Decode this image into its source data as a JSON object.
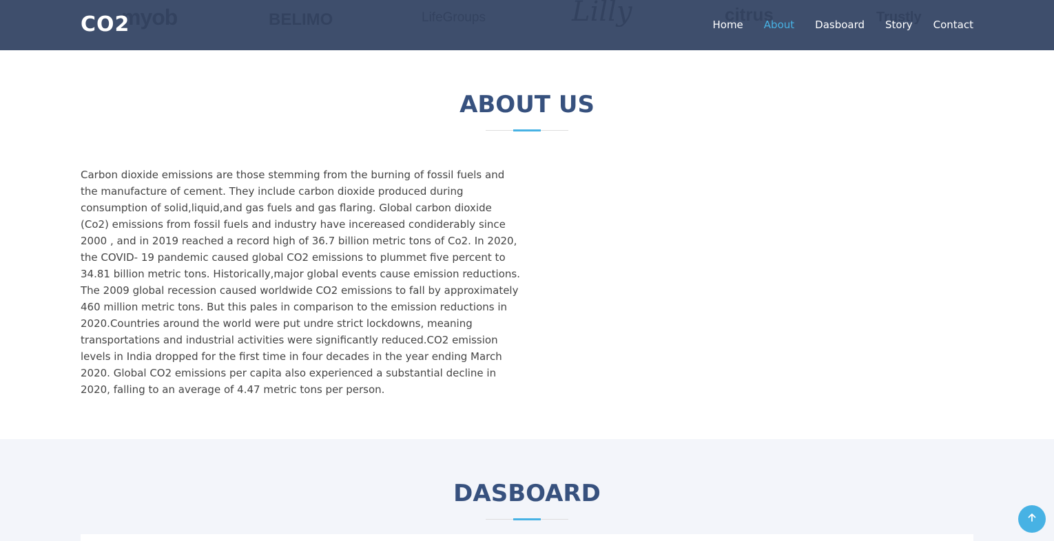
{
  "header": {
    "logo": "CO2",
    "client_logos": [
      "myob",
      "BELIMO",
      "LifeGroups",
      "Lilly",
      "citrus",
      "Trustly"
    ],
    "nav": [
      {
        "label": "Home",
        "active": false
      },
      {
        "label": "About",
        "active": true
      },
      {
        "label": "Dasboard",
        "active": false
      },
      {
        "label": "Story",
        "active": false
      },
      {
        "label": "Contact",
        "active": false
      }
    ]
  },
  "about": {
    "title": "ABOUT US",
    "paragraph": "Carbon dioxide emissions are those stemming from the burning of fossil fuels and the manufacture of cement. They include carbon dioxide produced during consumption of solid,liquid,and gas fuels and gas flaring. Global carbon dioxide (Co2) emissions from fossil fuels and industry have incereased condiderably since 2000 , and in 2019 reached a record high of 36.7 billion metric tons of Co2. In 2020, the COVID- 19 pandemic caused global CO2 emissions to plummet five percent to 34.81 billion metric tons. Historically,major global events cause emission reductions. The 2009 global recession caused worldwide CO2 emissions to fall by approximately 460 million metric tons. But this pales in comparison to the emission reductions in 2020.Countries around the world were put undre strict lockdowns, meaning transportations and industrial activities were significantly reduced.CO2 emission levels in India dropped for the first time in four decades in the year ending March 2020. Global CO2 emissions per capita also experienced a substantial decline in 2020, falling to an average of 4.47 metric tons per person."
  },
  "dashboard": {
    "title": "DASBOARD"
  },
  "back_to_top": {
    "icon": "arrow-up-icon"
  },
  "colors": {
    "header_bg": "#3e4e6c",
    "accent": "#47b2e4",
    "title": "#37517e",
    "section_bg": "#f3f5fa"
  }
}
